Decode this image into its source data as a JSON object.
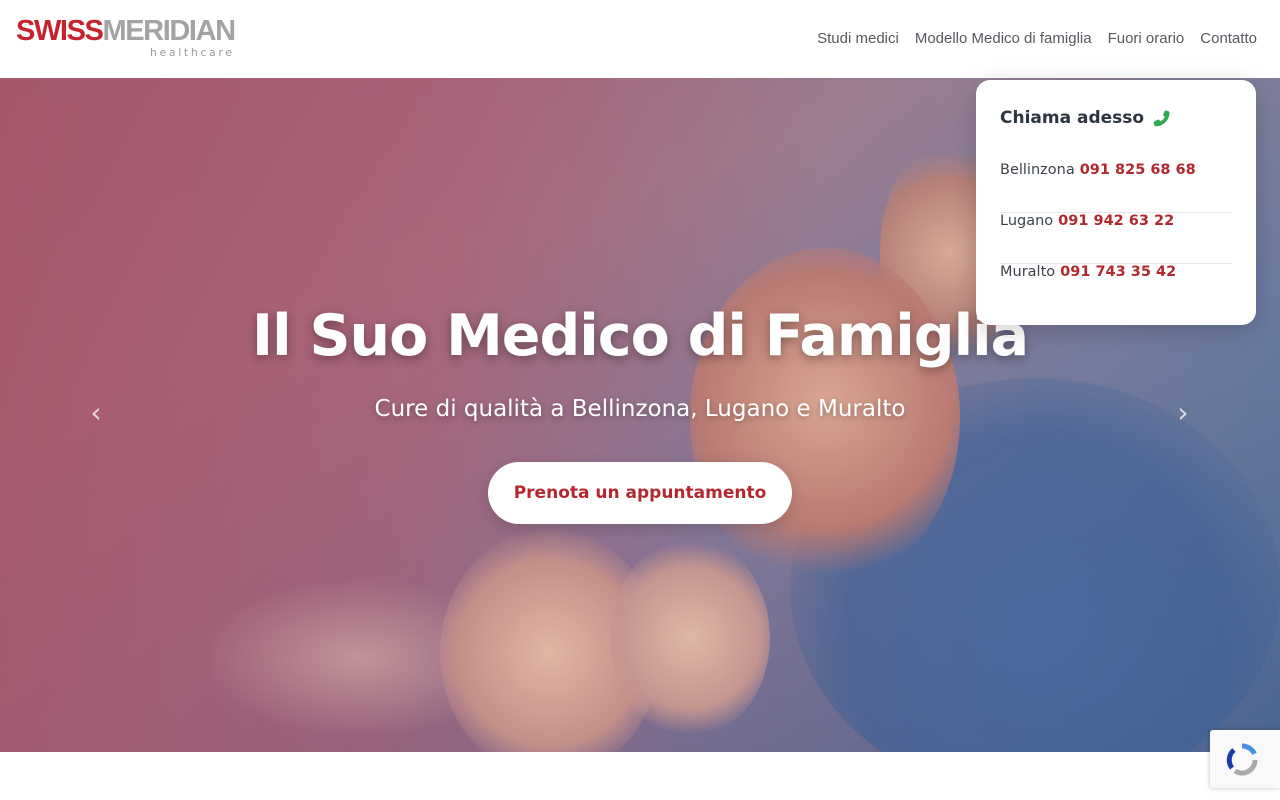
{
  "brand": {
    "name_part1": "SWISS",
    "name_part2": "MERIDIAN",
    "tagline": "healthcare",
    "accent_color": "#c8232c"
  },
  "nav": {
    "items": [
      {
        "label": "Studi medici"
      },
      {
        "label": "Modello Medico di famiglia"
      },
      {
        "label": "Fuori orario"
      },
      {
        "label": "Contatto"
      }
    ]
  },
  "hero": {
    "title": "Il Suo Medico di Famiglia",
    "subtitle": "Cure di qualità a Bellinzona, Lugano e Muralto",
    "cta_label": "Prenota un appuntamento",
    "prev_icon": "chevron-left-icon",
    "next_icon": "chevron-right-icon",
    "prev_glyph": "‹",
    "next_glyph": "›"
  },
  "call_card": {
    "title": "Chiama adesso",
    "icon": "phone-icon",
    "icon_color": "#2eaa52",
    "locations": [
      {
        "city": "Bellinzona",
        "phone": "091 825 68 68"
      },
      {
        "city": "Lugano",
        "phone": "091 942 63 22"
      },
      {
        "city": "Muralto",
        "phone": "091 743 35 42"
      }
    ]
  },
  "recaptcha": {
    "icon": "recaptcha-icon"
  }
}
